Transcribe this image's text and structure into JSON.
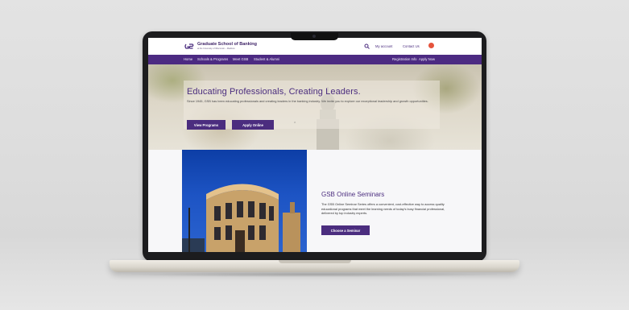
{
  "brand": {
    "name": "Graduate School of Banking",
    "subtitle": "at the University of Wisconsin – Madison"
  },
  "header": {
    "my_account": "My account",
    "contact_us": "Contact Us"
  },
  "nav": {
    "left": [
      "Home",
      "Schools & Programs",
      "Meet GSB",
      "Student & Alumni"
    ],
    "right": [
      "Registration Info",
      "Apply Now"
    ]
  },
  "hero": {
    "title": "Educating Professionals, Creating Leaders.",
    "text": "Since 1945, GSB has been educating professionals and creating leaders in the banking industry. We invite you to explore our exceptional leadership and growth opportunities.",
    "btn_programs": "View Programs",
    "btn_apply": "Apply Online"
  },
  "seminars": {
    "title": "GSB Online Seminars",
    "text": "The GSB Online Seminar Series offers a convenient, cost-effective way to access quality educational programs that meet the learning needs of today's busy financial professional, delivered by top industry experts.",
    "button": "Choose a Seminar"
  },
  "colors": {
    "brand_purple": "#4b2d7f",
    "accent_red": "#e5533c"
  },
  "icons": [
    "gsb-logo-icon",
    "search-icon",
    "cart-icon",
    "chevron-down-icon"
  ]
}
